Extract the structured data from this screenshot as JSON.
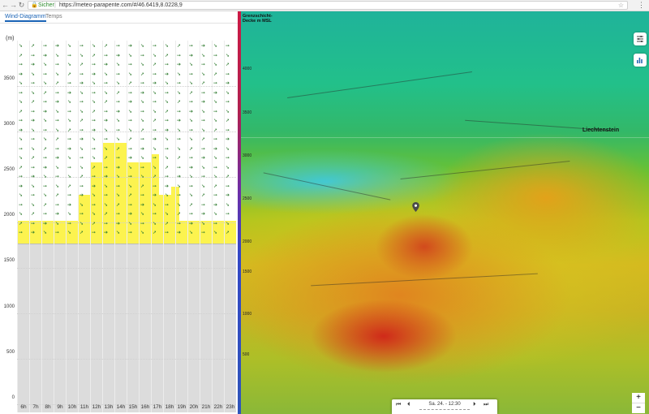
{
  "browser": {
    "secure_label": "Sicher",
    "separator": "|",
    "url": "https://meteo-parapente.com/#/46.6419,8.0228,9",
    "lock_icon": "lock-icon",
    "star_icon": "star-icon"
  },
  "tabs": [
    {
      "label": "Wind-Diagramm",
      "active": true
    },
    {
      "label": "Temps",
      "active": false
    }
  ],
  "diagram": {
    "unit": "(m)",
    "altitudes": [
      "3500",
      "3000",
      "2500",
      "2000",
      "1500",
      "1000",
      "500",
      "0"
    ],
    "hours": [
      "6h",
      "7h",
      "8h",
      "9h",
      "10h",
      "11h",
      "12h",
      "13h",
      "14h",
      "15h",
      "16h",
      "17h",
      "18h",
      "19h",
      "20h",
      "21h",
      "22h",
      "23h"
    ]
  },
  "map": {
    "legend_title": "Grenzschicht-Decke m MSL",
    "legend_altitudes": [
      "4000",
      "3500",
      "3000",
      "2500",
      "2000",
      "1500",
      "1000",
      "500"
    ],
    "place_label": "Liechtenstein",
    "time": {
      "label": "Sa. 24. - 12:30"
    },
    "zoom_in": "+",
    "zoom_out": "−"
  }
}
